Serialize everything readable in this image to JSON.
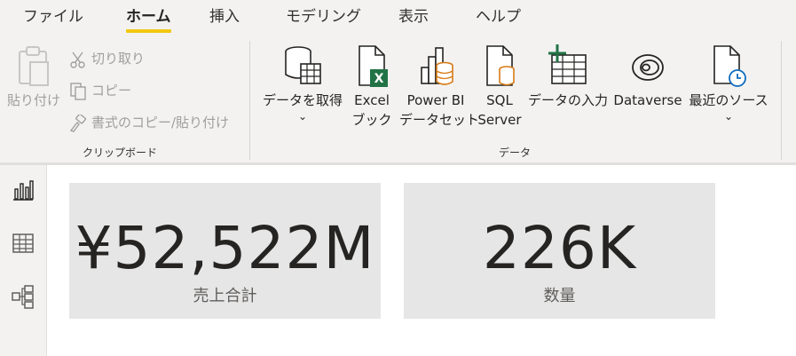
{
  "menu": {
    "tabs": [
      {
        "label": "ファイル"
      },
      {
        "label": "ホーム"
      },
      {
        "label": "挿入"
      },
      {
        "label": "モデリング"
      },
      {
        "label": "表示"
      },
      {
        "label": "ヘルプ"
      }
    ]
  },
  "ribbon": {
    "clipboard": {
      "paste_label": "貼り付け",
      "cut_label": "切り取り",
      "copy_label": "コピー",
      "format_painter_label": "書式のコピー/貼り付け",
      "group_label": "クリップボード"
    },
    "data": {
      "get_data_label": "データを取得",
      "excel_line1": "Excel",
      "excel_line2": "ブック",
      "pbi_line1": "Power BI",
      "pbi_line2": "データセット",
      "sql_line1": "SQL",
      "sql_line2": "Server",
      "enter_data_label": "データの入力",
      "dataverse_label": "Dataverse",
      "recent_sources_label": "最近のソース",
      "group_label": "データ"
    }
  },
  "cards": [
    {
      "value": "¥52,522M",
      "label": "売上合計"
    },
    {
      "value": "226K",
      "label": "数量"
    }
  ],
  "colors": {
    "accent": "#f2c811",
    "excel_green": "#217346",
    "orange": "#d87a16",
    "card_bg": "#e6e6e6"
  }
}
